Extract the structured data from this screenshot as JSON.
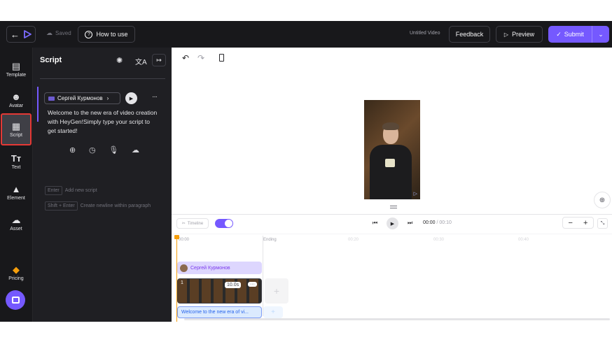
{
  "topbar": {
    "saved": "Saved",
    "how_to_use": "How to use",
    "video_title": "Untitled Video",
    "feedback": "Feedback",
    "preview": "Preview",
    "submit": "Submit"
  },
  "sidebar": {
    "items": [
      {
        "label": "Template",
        "icon": "template-icon"
      },
      {
        "label": "Avatar",
        "icon": "avatar-icon"
      },
      {
        "label": "Script",
        "icon": "script-icon"
      },
      {
        "label": "Text",
        "icon": "text-icon"
      },
      {
        "label": "Element",
        "icon": "element-icon"
      },
      {
        "label": "Asset",
        "icon": "upload-cloud-icon"
      }
    ],
    "pricing": "Pricing"
  },
  "panel": {
    "title": "Script",
    "voice_name": "Сергей Курмонов",
    "script_text": "Welcome to the new era of video creation with HeyGen!Simply type your script to get started!",
    "hint1_key": "Enter",
    "hint1_text": "Add new script",
    "hint2_key": "Shift + Enter",
    "hint2_text": "Create newline within paragraph"
  },
  "timeline": {
    "mode_label": "Timeline",
    "current_time": "00:00",
    "total_time": "00:10",
    "zoom_out": "−",
    "zoom_in": "+",
    "ticks": [
      "00:00",
      "Ending",
      "00:20",
      "00:30",
      "00:40"
    ],
    "avatar_track": "Сергей Курмонов",
    "clip_index": "1",
    "clip_duration": "10.0s",
    "clip_more": "···",
    "text_track": "Welcome to the new era of vi...",
    "add_plus": "+"
  },
  "colors": {
    "accent": "#7559ff",
    "dark_bg": "#18181b",
    "panel_bg": "#1f1f23",
    "highlight": "#e53935",
    "playhead": "#f59e0b",
    "avatar_track": "#ddd6fe",
    "text_track": "#dbeafe"
  }
}
